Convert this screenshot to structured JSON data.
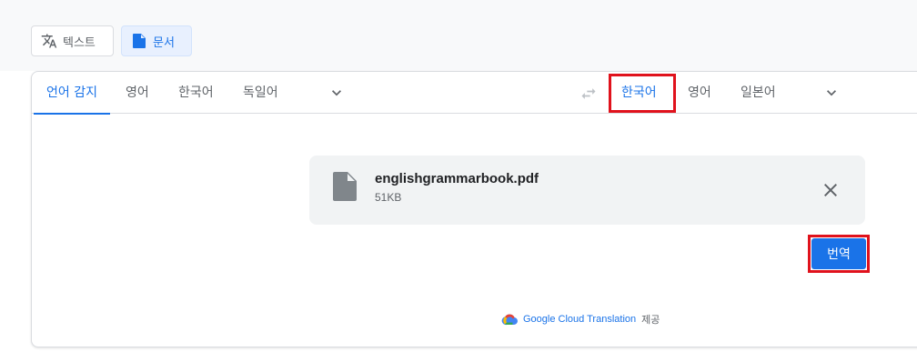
{
  "mode_tabs": {
    "text_label": "텍스트",
    "text_icon": "translate-icon",
    "document_label": "문서",
    "document_icon": "document-icon"
  },
  "source_langs": [
    "언어 감지",
    "영어",
    "한국어",
    "독일어"
  ],
  "source_active": "언어 감지",
  "target_langs": [
    "한국어",
    "영어",
    "일본어"
  ],
  "target_active": "한국어",
  "swap_icon": "swap-arrows-icon",
  "file": {
    "name": "englishgrammarbook.pdf",
    "size": "51KB",
    "icon": "file-icon",
    "close_icon": "close-icon"
  },
  "translate_button": "번역",
  "credit": {
    "provider": "Google Cloud Translation",
    "suffix": "제공",
    "logo": "google-cloud-logo"
  },
  "colors": {
    "accent": "#1a73e8",
    "highlight": "#e0121c",
    "file_bg": "#f1f3f4"
  }
}
